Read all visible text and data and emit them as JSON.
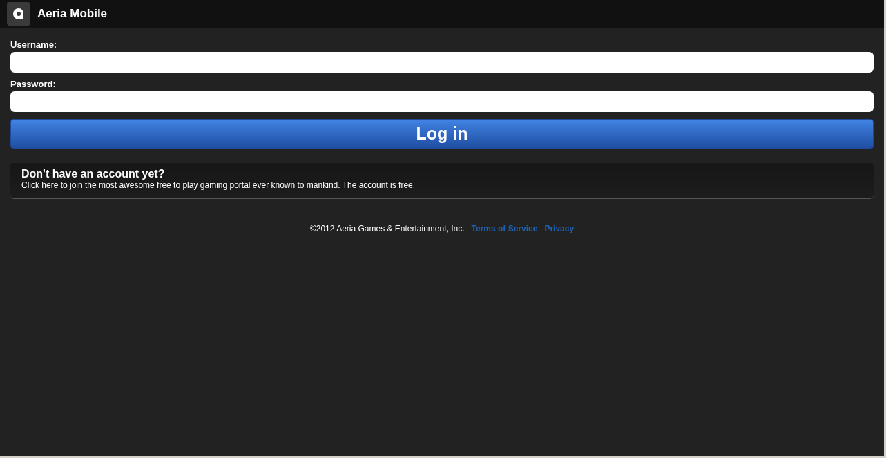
{
  "header": {
    "title": "Aeria Mobile"
  },
  "form": {
    "fields": [
      {
        "label": "Username:"
      },
      {
        "label": "Password:"
      }
    ],
    "submit": "Log in"
  },
  "signup": {
    "title": "Don't have an account yet?",
    "text": "Click here to join the most awesome free to play gaming portal ever known to mankind. The account is free."
  },
  "footer": {
    "copyright": "©2012 Aeria Games & Entertainment, Inc.",
    "links": [
      "Terms of Service",
      "Privacy"
    ]
  }
}
